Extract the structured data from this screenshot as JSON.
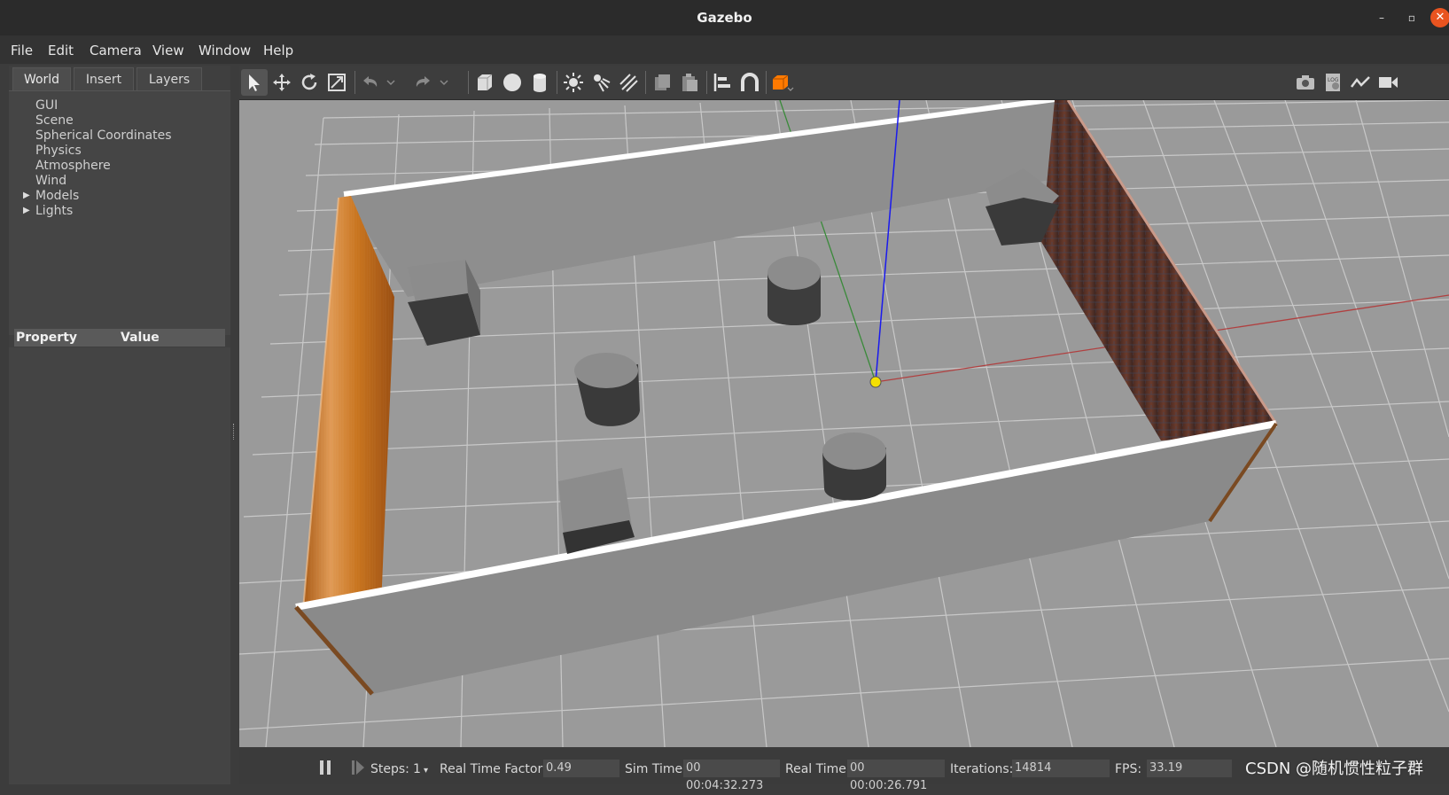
{
  "window": {
    "title": "Gazebo",
    "min_glyph": "–",
    "max_glyph": "▫",
    "close_glyph": "✕"
  },
  "menu": [
    {
      "label": "File"
    },
    {
      "label": "Edit"
    },
    {
      "label": "Camera"
    },
    {
      "label": "View"
    },
    {
      "label": "Window"
    },
    {
      "label": "Help"
    }
  ],
  "left_panel": {
    "tabs": [
      "World",
      "Insert",
      "Layers"
    ],
    "active_tab": "World",
    "tree": [
      "GUI",
      "Scene",
      "Spherical Coordinates",
      "Physics",
      "Atmosphere",
      "Wind",
      "Models",
      "Lights"
    ],
    "expandable": [
      "Models",
      "Lights"
    ],
    "property_header": "Property",
    "value_header": "Value"
  },
  "toolbar": {
    "left_tools": [
      "select-arrow-icon",
      "translate-icon",
      "rotate-icon",
      "scale-icon",
      "undo-icon",
      "redo-icon",
      "box-icon",
      "sphere-icon",
      "cylinder-icon",
      "point-light-icon",
      "spot-light-icon",
      "directional-light-icon",
      "copy-icon",
      "paste-icon",
      "align-icon",
      "snap-icon",
      "view-angle-icon"
    ],
    "right_tools": [
      "screenshot-icon",
      "log-icon",
      "plot-icon",
      "record-video-icon"
    ]
  },
  "bottom": {
    "steps_label": "Steps:",
    "steps_value": "1",
    "rtf_label": "Real Time Factor:",
    "rtf_value": "0.49",
    "sim_time_label": "Sim Time:",
    "sim_time_value": "00 00:04:32.273",
    "real_time_label": "Real Time:",
    "real_time_value": "00 00:00:26.791",
    "iterations_label": "Iterations:",
    "iterations_value": "14814",
    "fps_label": "FPS:",
    "fps_value": "33.19"
  },
  "watermark": "CSDN @随机惯性粒子群",
  "colors": {
    "ground": "#9a9a9a",
    "grid": "#c4c4c4",
    "wall": "#8a8a8a",
    "wood": "#c8741e",
    "brick": "#6b3b2c",
    "obstacle": "#3a3a3a",
    "accent": "#ff7a00",
    "close": "#e95420"
  }
}
